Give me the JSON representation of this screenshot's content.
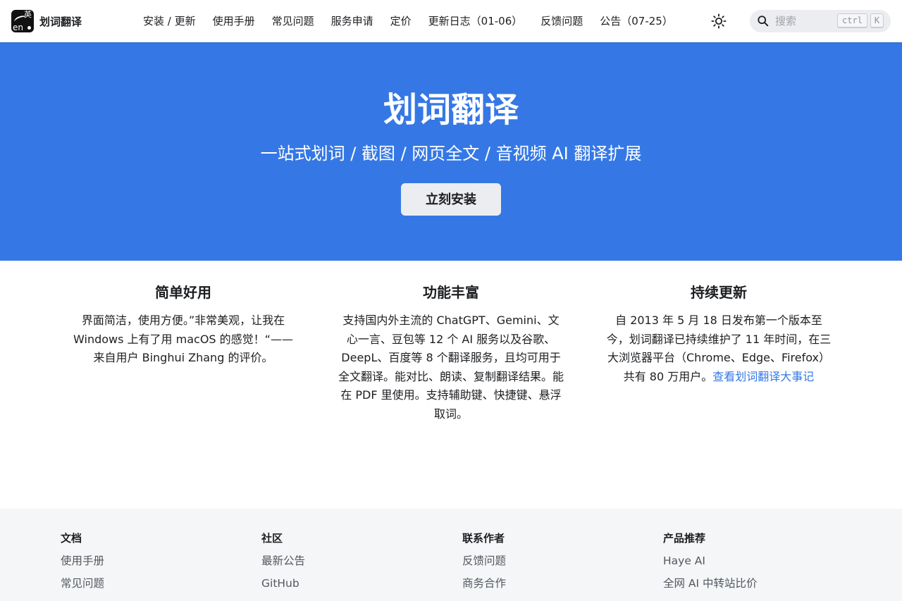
{
  "brand": {
    "logo_text_top": "英",
    "logo_text_bottom": "en",
    "title": "划词翻译"
  },
  "nav": {
    "links": [
      "安装 / 更新",
      "使用手册",
      "常见问题",
      "服务申请",
      "定价",
      "更新日志（01-06）",
      "反馈问题",
      "公告（07-25）"
    ],
    "theme_icon": "sun-icon"
  },
  "search": {
    "placeholder": "搜索",
    "key_ctrl": "ctrl",
    "key_k": "K"
  },
  "hero": {
    "title": "划词翻译",
    "subtitle": "一站式划词 / 截图 / 网页全文 / 音视频 AI 翻译扩展",
    "install_label": "立刻安装"
  },
  "features": [
    {
      "title": "简单好用",
      "description": "界面简洁，使用方便。”非常美观，让我在 Windows 上有了用 macOS 的感觉！“—— 来自用户 Binghui Zhang 的评价。"
    },
    {
      "title": "功能丰富",
      "description": "支持国内外主流的 ChatGPT、Gemini、文心一言、豆包等 12 个 AI 服务以及谷歌、DeepL、百度等 8 个翻译服务，且均可用于全文翻译。能对比、朗读、复制翻译结果。能在 PDF 里使用。支持辅助键、快捷键、悬浮取词。"
    },
    {
      "title": "持续更新",
      "description": "自 2013 年 5 月 18 日发布第一个版本至今，划词翻译已持续维护了 11 年时间，在三大浏览器平台（Chrome、Edge、Firefox）共有 80 万用户。",
      "link": "查看划词翻译大事记"
    }
  ],
  "footer": {
    "columns": [
      {
        "title": "文档",
        "items": [
          "使用手册",
          "常见问题"
        ]
      },
      {
        "title": "社区",
        "items": [
          "最新公告",
          "GitHub"
        ]
      },
      {
        "title": "联系作者",
        "items": [
          "反馈问题",
          "商务合作"
        ]
      },
      {
        "title": "产品推荐",
        "items": [
          "Haye AI",
          "全网 AI 中转站比价"
        ]
      }
    ]
  },
  "colors": {
    "hero_background": "#3578e5",
    "link": "#3578e5",
    "footer_background": "#f5f6f7"
  }
}
